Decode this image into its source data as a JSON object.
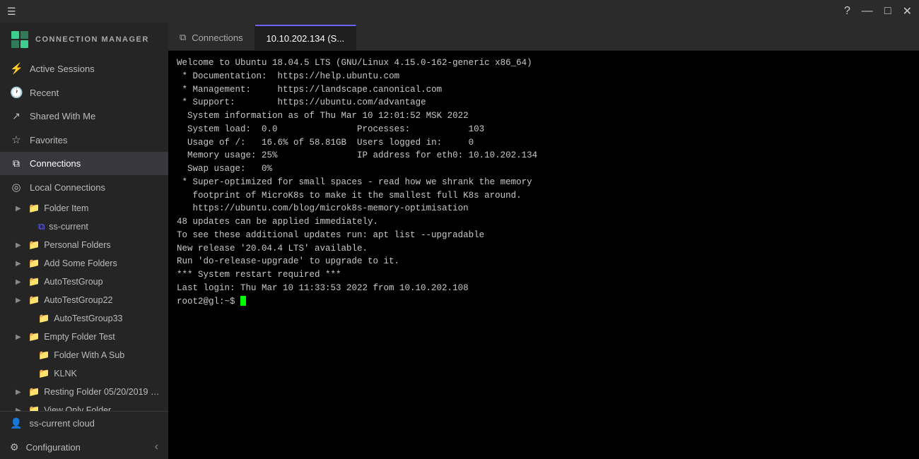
{
  "topbar": {
    "hamburger": "☰",
    "right_icons": [
      "?",
      "—",
      "□",
      "✕"
    ]
  },
  "logo": {
    "text": "CONNECTION MANAGER"
  },
  "nav": {
    "items": [
      {
        "id": "active-sessions",
        "label": "Active Sessions",
        "icon": "⚡"
      },
      {
        "id": "recent",
        "label": "Recent",
        "icon": "🕐"
      },
      {
        "id": "shared-with-me",
        "label": "Shared With Me",
        "icon": "↗"
      },
      {
        "id": "favorites",
        "label": "Favorites",
        "icon": "☆"
      },
      {
        "id": "connections",
        "label": "Connections",
        "icon": "⧉",
        "active": true
      },
      {
        "id": "local-connections",
        "label": "Local Connections",
        "icon": "◎"
      }
    ]
  },
  "tree": {
    "items": [
      {
        "id": "folder-item",
        "label": "Folder Item",
        "indent": 1,
        "hasArrow": true,
        "expanded": false
      },
      {
        "id": "ss-current",
        "label": "ss-current",
        "indent": 2,
        "hasArrow": false,
        "isFile": true
      },
      {
        "id": "personal-folders",
        "label": "Personal Folders",
        "indent": 1,
        "hasArrow": true,
        "expanded": false
      },
      {
        "id": "add-some-folders",
        "label": "Add Some Folders",
        "indent": 1,
        "hasArrow": true,
        "expanded": false
      },
      {
        "id": "autotestgroup",
        "label": "AutoTestGroup",
        "indent": 1,
        "hasArrow": true,
        "expanded": false
      },
      {
        "id": "autotestgroup22",
        "label": "AutoTestGroup22",
        "indent": 1,
        "hasArrow": true,
        "expanded": false
      },
      {
        "id": "autotestgroup33",
        "label": "AutoTestGroup33",
        "indent": 2,
        "hasArrow": false,
        "expanded": false
      },
      {
        "id": "empty-folder-test",
        "label": "Empty Folder Test",
        "indent": 1,
        "hasArrow": true,
        "expanded": false
      },
      {
        "id": "folder-with-sub",
        "label": "Folder With A Sub",
        "indent": 2,
        "hasArrow": false,
        "expanded": false
      },
      {
        "id": "klnk",
        "label": "KLNK",
        "indent": 2,
        "hasArrow": false,
        "expanded": false
      },
      {
        "id": "resting-folder",
        "label": "Resting Folder 05/20/2019 1…",
        "indent": 1,
        "hasArrow": true,
        "expanded": false
      },
      {
        "id": "view-only-folder",
        "label": "View Only Folder",
        "indent": 1,
        "hasArrow": true,
        "expanded": false
      }
    ]
  },
  "bottom": {
    "items": [
      {
        "id": "ss-current-cloud",
        "label": "ss-current cloud",
        "icon": "👤"
      },
      {
        "id": "configuration",
        "label": "Configuration",
        "icon": "⚙"
      }
    ],
    "collapse_icon": "‹"
  },
  "tabs": [
    {
      "id": "connections-tab",
      "label": "Connections",
      "icon": "⧉",
      "active": false
    },
    {
      "id": "session-tab",
      "label": "10.10.202.134 (S...",
      "icon": "",
      "active": true
    }
  ],
  "terminal": {
    "lines": [
      "Welcome to Ubuntu 18.04.5 LTS (GNU/Linux 4.15.0-162-generic x86_64)",
      "",
      " * Documentation:  https://help.ubuntu.com",
      " * Management:     https://landscape.canonical.com",
      " * Support:        https://ubuntu.com/advantage",
      "",
      "  System information as of Thu Mar 10 12:01:52 MSK 2022",
      "",
      "  System load:  0.0               Processes:           103",
      "  Usage of /:   16.6% of 58.81GB  Users logged in:     0",
      "  Memory usage: 25%               IP address for eth0: 10.10.202.134",
      "  Swap usage:   0%",
      "",
      " * Super-optimized for small spaces - read how we shrank the memory",
      "   footprint of MicroK8s to make it the smallest full K8s around.",
      "",
      "   https://ubuntu.com/blog/microk8s-memory-optimisation",
      "",
      "48 updates can be applied immediately.",
      "To see these additional updates run: apt list --upgradable",
      "",
      "New release '20.04.4 LTS' available.",
      "Run 'do-release-upgrade' to upgrade to it.",
      "",
      "",
      "*** System restart required ***",
      "Last login: Thu Mar 10 11:33:53 2022 from 10.10.202.108",
      "root2@gl:~$ "
    ]
  }
}
